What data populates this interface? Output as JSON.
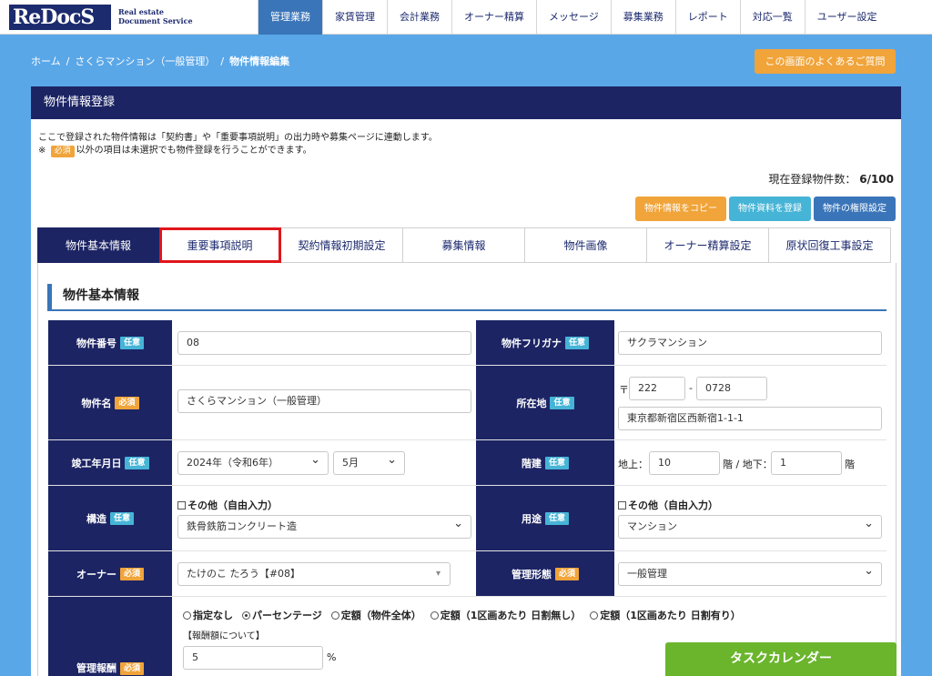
{
  "brand": {
    "logo_text": "ReDocS",
    "sub1": "Real estate",
    "sub2": "Document Service"
  },
  "nav": [
    {
      "label": "管理業務",
      "active": true
    },
    {
      "label": "家賃管理"
    },
    {
      "label": "会計業務"
    },
    {
      "label": "オーナー精算"
    },
    {
      "label": "メッセージ"
    },
    {
      "label": "募集業務"
    },
    {
      "label": "レポート"
    },
    {
      "label": "対応一覧"
    },
    {
      "label": "ユーザー設定"
    }
  ],
  "breadcrumb": {
    "home": "ホーム",
    "sep": "/",
    "property": "さくらマンション（一般管理）",
    "current": "物件情報編集"
  },
  "faq_button": "この画面のよくあるご質問",
  "panel": {
    "title": "物件情報登録",
    "note1": "ここで登録された物件情報は「契約書」や「重要事項説明」の出力時や募集ページに連動します。",
    "note2_prefix": "※",
    "note2_badge": "必須",
    "note2_suffix": "以外の項目は未選択でも物件登録を行うことができます。",
    "count_label": "現在登録物件数：",
    "count_value": "6/100"
  },
  "actions": {
    "copy": "物件情報をコピー",
    "docs": "物件資料を登録",
    "perm": "物件の権限設定"
  },
  "tabs": [
    "物件基本情報",
    "重要事項説明",
    "契約情報初期設定",
    "募集情報",
    "物件画像",
    "オーナー精算設定",
    "原状回復工事設定"
  ],
  "section_title": "物件基本情報",
  "badges": {
    "optional": "任意",
    "required": "必須"
  },
  "form": {
    "number_label": "物件番号",
    "number_value": "08",
    "kana_label": "物件フリガナ",
    "kana_value": "サクラマンション",
    "name_label": "物件名",
    "name_value": "さくらマンション（一般管理）",
    "address_label": "所在地",
    "zip_mark": "〒",
    "zip1": "222",
    "zip_dash": "-",
    "zip2": "0728",
    "address_value": "東京都新宿区西新宿1-1-1",
    "built_label": "竣工年月日",
    "built_year": "2024年（令和6年）",
    "built_month": "5月",
    "floors_label": "階建",
    "above_label": "地上：",
    "above_value": "10",
    "below_label": "階 / 地下：",
    "below_value": "1",
    "floor_unit": "階",
    "structure_label": "構造",
    "structure_other": "その他（自由入力）",
    "structure_value": "鉄骨鉄筋コンクリート造",
    "usage_label": "用途",
    "usage_other": "その他（自由入力）",
    "usage_value": "マンション",
    "owner_label": "オーナー",
    "owner_value": "たけのこ たろう【#08】",
    "mgmt_label": "管理形態",
    "mgmt_value": "一般管理",
    "fee_label": "管理報酬",
    "fee_options": [
      "指定なし",
      "パーセンテージ",
      "定額（物件全体）",
      "定額（1区画あたり 日割無し）",
      "定額（1区画あたり 日割有り）"
    ],
    "fee_note": "【報酬額について】",
    "fee_value": "5",
    "fee_unit": "%"
  },
  "task_calendar": "タスクカレンダー",
  "colors": {
    "navy": "#1c2464",
    "accent_blue": "#3a75b9",
    "orange": "#f0a43a",
    "cyan": "#46b4d6",
    "green": "#6bb52d",
    "highlight_red": "#e0161b"
  }
}
